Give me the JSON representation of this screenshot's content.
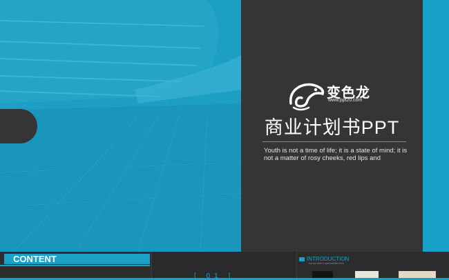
{
  "slide": {
    "brand_name": "变色龙",
    "brand_url": "www.ppt20.com",
    "title": "商业计划书PPT",
    "subtitle": "Youth is not a time of life; it is a state of mind; it is not a matter of rosy cheeks, red lips and",
    "logo_icon": "chameleon-logo-icon"
  },
  "thumbnails": {
    "content_label": "CONTENT",
    "introduction_label": "INTRODUCTION",
    "introduction_sub": "You are click to add subtitles here",
    "middle_mark": "[ 01 ]"
  },
  "colors": {
    "accent": "#19a1c8",
    "dark_panel": "#353537",
    "hero": "#1c9ec3"
  }
}
